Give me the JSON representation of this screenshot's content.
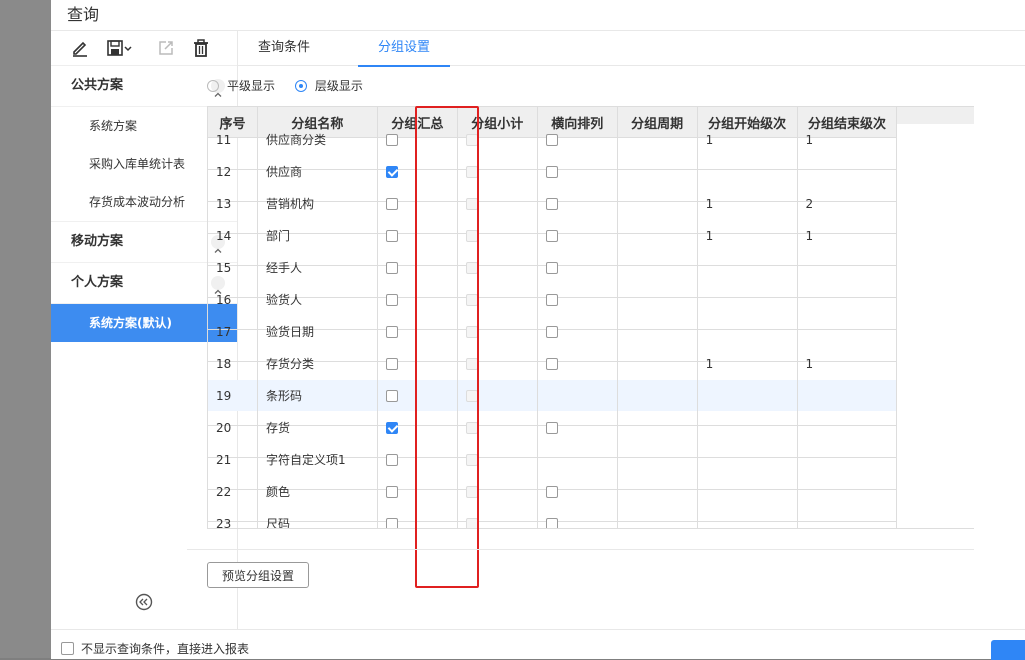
{
  "dialog": {
    "title": "查询"
  },
  "sidebar": {
    "toolbar": [
      "edit-icon",
      "save-icon",
      "export-icon",
      "delete-icon"
    ],
    "groups": [
      {
        "label": "公共方案",
        "items": [
          "系统方案",
          "采购入库单统计表",
          "存货成本波动分析"
        ]
      },
      {
        "label": "移动方案",
        "items": []
      },
      {
        "label": "个人方案",
        "items": [
          "系统方案(默认)"
        ]
      }
    ]
  },
  "tabs": [
    "查询条件",
    "分组设置"
  ],
  "active_tab": "分组设置",
  "radio": {
    "option1": "平级显示",
    "option2": "层级显示",
    "selected": "层级显示"
  },
  "table": {
    "headers": [
      "序号",
      "分组名称",
      "分组汇总",
      "分组小计",
      "横向排列",
      "分组周期",
      "分组开始级次",
      "分组结束级次"
    ],
    "rows": [
      {
        "no": "11",
        "name": "供应商分类",
        "summary": false,
        "subtotal": "disabled",
        "horizontal": false,
        "period": "",
        "start": "1",
        "end": "1"
      },
      {
        "no": "12",
        "name": "供应商",
        "summary": true,
        "subtotal": "disabled",
        "horizontal": false,
        "period": "",
        "start": "",
        "end": ""
      },
      {
        "no": "13",
        "name": "营销机构",
        "summary": false,
        "subtotal": "disabled",
        "horizontal": false,
        "period": "",
        "start": "1",
        "end": "2"
      },
      {
        "no": "14",
        "name": "部门",
        "summary": false,
        "subtotal": "disabled",
        "horizontal": false,
        "period": "",
        "start": "1",
        "end": "1"
      },
      {
        "no": "15",
        "name": "经手人",
        "summary": false,
        "subtotal": "disabled",
        "horizontal": false,
        "period": "",
        "start": "",
        "end": ""
      },
      {
        "no": "16",
        "name": "验货人",
        "summary": false,
        "subtotal": "disabled",
        "horizontal": false,
        "period": "",
        "start": "",
        "end": ""
      },
      {
        "no": "17",
        "name": "验货日期",
        "summary": false,
        "subtotal": "disabled",
        "horizontal": false,
        "period": "",
        "start": "",
        "end": ""
      },
      {
        "no": "18",
        "name": "存货分类",
        "summary": false,
        "subtotal": "disabled",
        "horizontal": false,
        "period": "",
        "start": "1",
        "end": "1"
      },
      {
        "no": "19",
        "name": "条形码",
        "summary": false,
        "subtotal": "disabled",
        "horizontal": "none",
        "period": "",
        "start": "",
        "end": ""
      },
      {
        "no": "20",
        "name": "存货",
        "summary": true,
        "subtotal": "disabled",
        "horizontal": false,
        "period": "",
        "start": "",
        "end": ""
      },
      {
        "no": "21",
        "name": "字符自定义项1",
        "summary": false,
        "subtotal": "disabled",
        "horizontal": "none",
        "period": "",
        "start": "",
        "end": ""
      },
      {
        "no": "22",
        "name": "颜色",
        "summary": false,
        "subtotal": "disabled",
        "horizontal": false,
        "period": "",
        "start": "",
        "end": ""
      },
      {
        "no": "23",
        "name": "尺码",
        "summary": false,
        "subtotal": "disabled",
        "horizontal": false,
        "period": "",
        "start": "",
        "end": ""
      }
    ]
  },
  "preview_button": "预览分组设置",
  "footer": {
    "checkbox_label": "不显示查询条件，直接进入报表"
  }
}
